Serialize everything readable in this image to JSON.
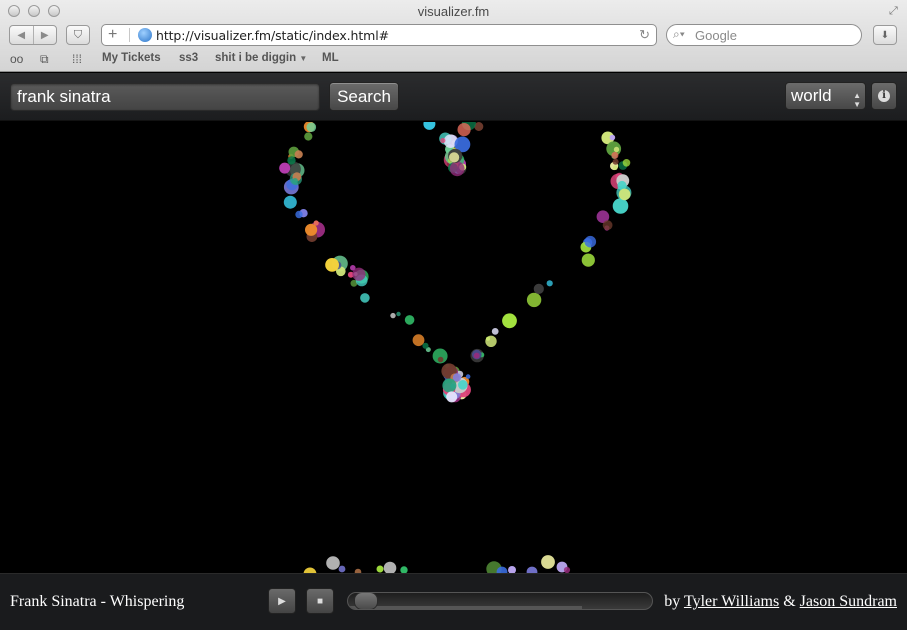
{
  "window": {
    "title": "visualizer.fm",
    "url": "http://visualizer.fm/static/index.html#",
    "search_placeholder": "Google"
  },
  "bookmarks": [
    "My Tickets",
    "ss3",
    "shit i be diggin",
    "ML"
  ],
  "app": {
    "query": "frank sinatra",
    "search_label": "Search",
    "scope_value": "world"
  },
  "player": {
    "now_playing": "Frank Sinatra - Whispering",
    "progress_fraction": 0.02,
    "loaded_fraction": 0.77,
    "credits_prefix": "by",
    "author_1": "Tyler Williams",
    "credits_joiner": "&",
    "author_2": "Jason Sundram"
  },
  "colors": {
    "accent": "#1c1d1f",
    "stage": "#000000",
    "bubble_palette": [
      "#e0457b",
      "#37c8e6",
      "#7f7fe3",
      "#ee8b2c",
      "#33c26b",
      "#a5e63f",
      "#d0e67a",
      "#6f3b2d",
      "#b83db1",
      "#3a6de0",
      "#8c1a3a",
      "#6fd19a",
      "#c9c9c9",
      "#4a4a8c",
      "#f4d23c",
      "#2aa17f",
      "#e66b5b",
      "#5ea03e",
      "#bba6f0",
      "#e6e6ff",
      "#962b7d",
      "#0a7a4a",
      "#c27d50",
      "#3c3c3c",
      "#47d4c8",
      "#f1f1a3"
    ]
  }
}
